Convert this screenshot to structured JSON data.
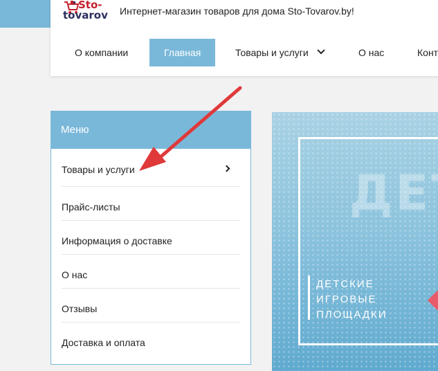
{
  "header": {
    "logo_line1": "Sto-",
    "logo_line2": "tovarov",
    "tagline": "Интернет-магазин товаров для дома Sto-Tovarov.by!"
  },
  "nav": {
    "items": [
      {
        "label": "О компании"
      },
      {
        "label": "Главная",
        "active": true
      },
      {
        "label": "Товары и услуги",
        "dropdown": true
      },
      {
        "label": "О нас"
      },
      {
        "label": "Конт"
      }
    ]
  },
  "menu": {
    "title": "Меню",
    "items": [
      {
        "label": "Товары и услуги",
        "has_submenu": true
      },
      {
        "label": "Прайс-листы"
      },
      {
        "label": "Информация о доставке"
      },
      {
        "label": "О нас"
      },
      {
        "label": "Отзывы"
      },
      {
        "label": "Доставка и оплата"
      }
    ]
  },
  "banner": {
    "big_text": "ДЕТ",
    "line1": "ДЕТСКИЕ",
    "line2": "ИГРОВЫЕ",
    "line3": "ПЛОЩАДКИ"
  },
  "colors": {
    "accent": "#7ab8d9",
    "arrow": "#e0393a",
    "logo_red": "#c4202c",
    "logo_navy": "#2b2f5e"
  },
  "icons": [
    "cart-logo-icon",
    "chevron-down-icon",
    "chevron-right-icon",
    "annotation-arrow-icon"
  ]
}
